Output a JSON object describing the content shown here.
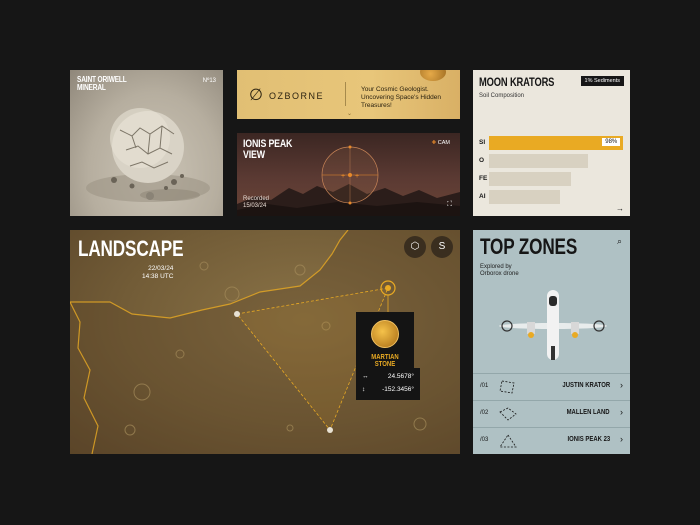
{
  "mineral_card": {
    "title_line1": "SAINT ORIWELL",
    "title_line2": "MINERAL",
    "number": "Nº13"
  },
  "brand_card": {
    "logo_glyph": "∅",
    "logo_text": "OZBORNE",
    "tagline_line1": "Your Cosmic Geologist.",
    "tagline_line2": "Uncovering Space's Hidden Treasures!",
    "chevron": "⌄"
  },
  "peak_card": {
    "title_line1": "IONIS PEAK",
    "title_line2": "VIEW",
    "cam_label": "CAM",
    "recorded_label": "Recorded",
    "recorded_date": "15/03/24",
    "fullscreen_icon": "fullscreen-icon"
  },
  "krators_card": {
    "title": "MOON KRATORS",
    "badge": "1% Sediments",
    "subtitle": "Soil Composition",
    "rows": [
      {
        "label": "SI",
        "value": 98,
        "display": "98%",
        "active": true
      },
      {
        "label": "O",
        "value": 72,
        "display": "",
        "active": false
      },
      {
        "label": "FE",
        "value": 60,
        "display": "",
        "active": false
      },
      {
        "label": "AI",
        "value": 52,
        "display": "",
        "active": false
      }
    ],
    "arrow": "→"
  },
  "landscape_card": {
    "title": "LANDSCAPE",
    "date": "22/03/24",
    "time": "14:38 UTC",
    "buttons": [
      {
        "icon": "cube-icon",
        "glyph": "⬡"
      },
      {
        "icon": "route-icon",
        "glyph": "S"
      }
    ],
    "poi": {
      "name": "MARTIAN STONE"
    },
    "coords": [
      {
        "icon": "↔",
        "value": "24.5678°"
      },
      {
        "icon": "↕",
        "value": "-152.3456°"
      }
    ]
  },
  "zones_card": {
    "title": "TOP ZONES",
    "subtitle_line1": "Explored by",
    "subtitle_line2": "Orborox drone",
    "search_icon": "search-icon",
    "zones": [
      {
        "index": "/01",
        "name": "JUSTIN KRATOR"
      },
      {
        "index": "/02",
        "name": "MALLEN LAND"
      },
      {
        "index": "/03",
        "name": "IONIS PEAK 23"
      }
    ]
  },
  "colors": {
    "background": "#161616",
    "accent": "#e9aa23",
    "panel_light": "#ebe7dd",
    "panel_teal": "#afc1c4"
  }
}
